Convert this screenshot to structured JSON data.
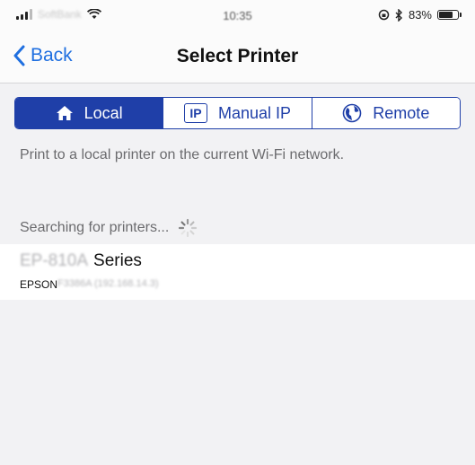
{
  "status_bar": {
    "carrier": "SoftBank",
    "time": "10:35",
    "battery_percent": "83%",
    "battery_level": 0.83
  },
  "nav": {
    "back_label": "Back",
    "title": "Select Printer"
  },
  "tabs": [
    {
      "label": "Local",
      "icon": "home-icon",
      "active": true
    },
    {
      "label": "Manual IP",
      "icon": "ip-icon",
      "icon_text": "IP",
      "active": false
    },
    {
      "label": "Remote",
      "icon": "globe-icon",
      "active": false
    }
  ],
  "description": "Print to a local printer on the current Wi-Fi network.",
  "searching_text": "Searching for printers...",
  "printers": [
    {
      "model_prefix": "EP-810A",
      "name_suffix": "Series",
      "vendor": "EPSON",
      "id_ip": "F3386A (192.168.14.3)"
    }
  ],
  "colors": {
    "accent": "#1f3fa8",
    "link": "#1f6fe0",
    "background": "#f2f2f4"
  }
}
